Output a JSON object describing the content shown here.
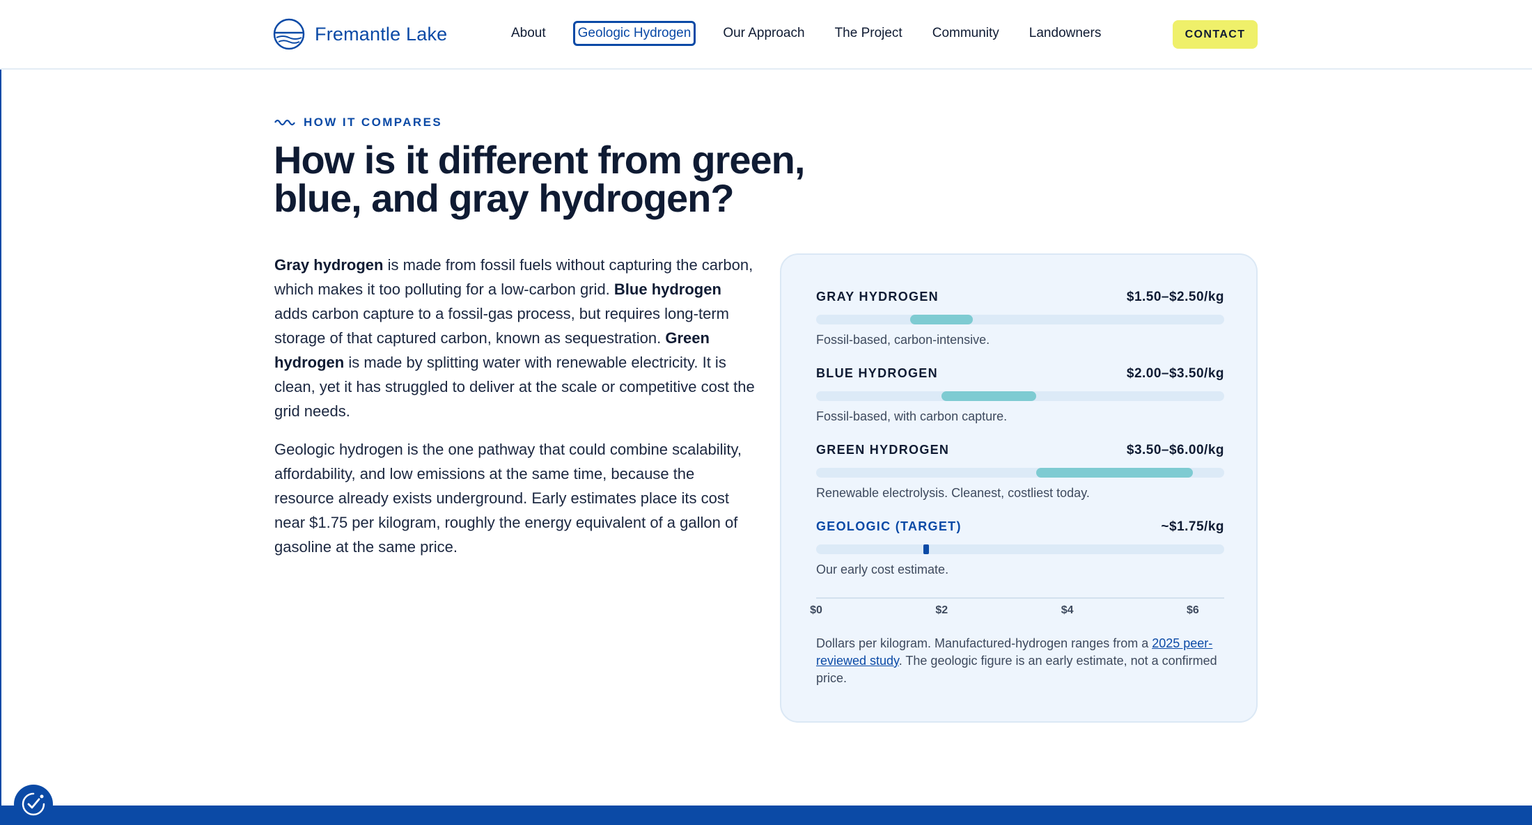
{
  "header": {
    "logo_text": "Fremantle Lake",
    "nav": [
      "About",
      "Geologic Hydrogen",
      "Our Approach",
      "The Project",
      "Community",
      "Landowners"
    ],
    "contact_label": "CONTACT"
  },
  "section": {
    "eyebrow": "HOW IT COMPARES",
    "title_line1": "How is it different from green,",
    "title_line2": "blue, and gray hydrogen?"
  },
  "body": {
    "p1": [
      {
        "text": "Gray hydrogen",
        "bold": true
      },
      {
        "text": " is made from fossil fuels without capturing the carbon, which makes it too polluting for a low-carbon grid. ",
        "bold": false
      },
      {
        "text": "Blue hydrogen",
        "bold": true
      },
      {
        "text": " adds carbon capture to a fossil-gas process, but requires long-term storage of that captured carbon, known as sequestration. ",
        "bold": false
      },
      {
        "text": "Green hydrogen",
        "bold": true
      },
      {
        "text": " is made by splitting water with renewable electricity. It is clean, yet it has struggled to deliver at the scale or competitive cost the grid needs.",
        "bold": false
      }
    ],
    "p2": "Geologic hydrogen is the one pathway that could combine scalability, affordability, and low emissions at the same time, because the resource already exists underground. Early estimates place its cost near $1.75 per kilogram, roughly the energy equivalent of a gallon of gasoline at the same price."
  },
  "comparison": {
    "rows": [
      {
        "name": "GRAY HYDROGEN",
        "price": "$1.50–$2.50/kg",
        "desc": "Fossil-based, carbon-intensive."
      },
      {
        "name": "BLUE HYDROGEN",
        "price": "$2.00–$3.50/kg",
        "desc": "Fossil-based, with carbon capture."
      },
      {
        "name": "GREEN HYDROGEN",
        "price": "$3.50–$6.00/kg",
        "desc": "Renewable electrolysis. Cleanest, costliest today."
      },
      {
        "name": "GEOLOGIC (TARGET)",
        "price": "~$1.75/kg",
        "desc": "Our early cost estimate."
      }
    ],
    "ticks": [
      "$0",
      "$2",
      "$4",
      "$6"
    ],
    "footnote_before": "Dollars per kilogram. Manufactured-hydrogen ranges from a ",
    "footnote_link": "2025 peer-reviewed study",
    "footnote_after": ". The geologic figure is an early estimate, not a confirmed price."
  },
  "chart_data": {
    "type": "bar",
    "categories": [
      "GRAY HYDROGEN",
      "BLUE HYDROGEN",
      "GREEN HYDROGEN",
      "GEOLOGIC (TARGET)"
    ],
    "ranges": [
      [
        1.5,
        2.5
      ],
      [
        2.0,
        3.5
      ],
      [
        3.5,
        6.0
      ],
      [
        1.75,
        1.75
      ]
    ],
    "xlabel": "Dollars per kilogram",
    "xlim": [
      0,
      6.5
    ],
    "xticks": [
      0,
      2,
      4,
      6
    ],
    "colors": {
      "range": "#7ecbd2",
      "marker": "#0b4aa6",
      "track": "#dceaf7"
    }
  }
}
